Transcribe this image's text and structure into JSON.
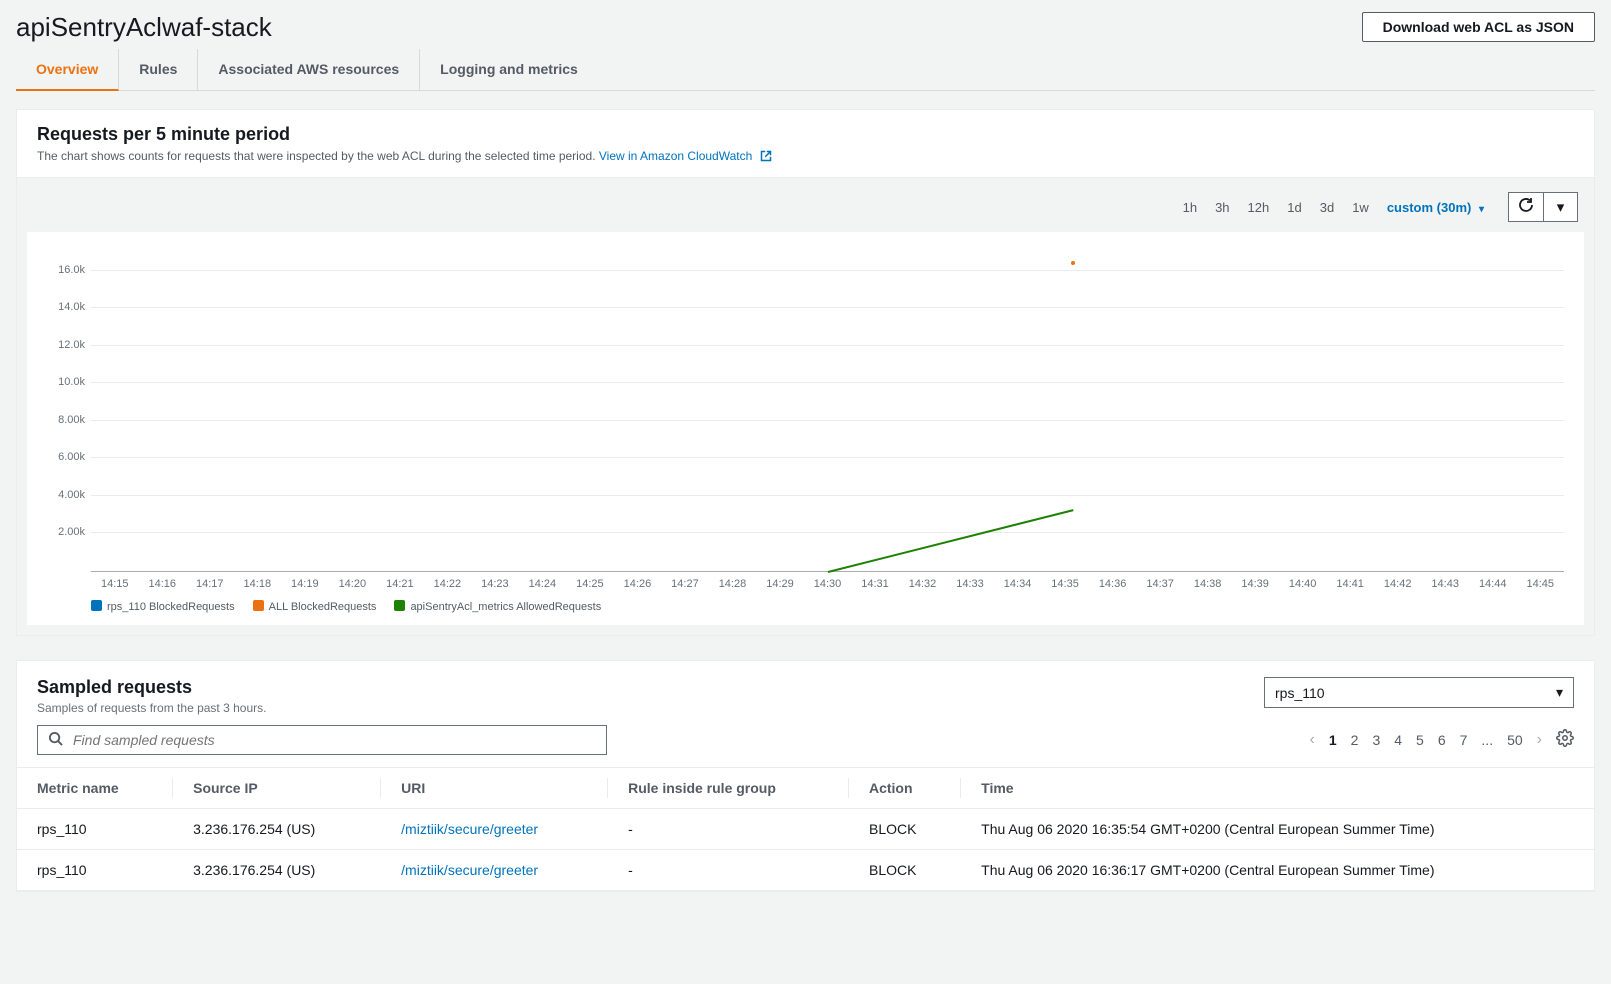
{
  "header": {
    "title": "apiSentryAclwaf-stack",
    "download_btn": "Download web ACL as JSON"
  },
  "tabs": [
    {
      "label": "Overview",
      "active": true
    },
    {
      "label": "Rules",
      "active": false
    },
    {
      "label": "Associated AWS resources",
      "active": false
    },
    {
      "label": "Logging and metrics",
      "active": false
    }
  ],
  "chart_panel": {
    "title": "Requests per 5 minute period",
    "subtitle": "The chart shows counts for requests that were inspected by the web ACL during the selected time period.",
    "cloudwatch_link": "View in Amazon CloudWatch",
    "time_ranges": [
      "1h",
      "3h",
      "12h",
      "1d",
      "3d",
      "1w"
    ],
    "custom_label": "custom (30m)"
  },
  "chart_data": {
    "type": "line",
    "title": "",
    "xlabel": "",
    "ylabel": "",
    "ylim": [
      0,
      17000
    ],
    "y_ticks": [
      "16.0k",
      "14.0k",
      "12.0k",
      "10.0k",
      "8.00k",
      "6.00k",
      "4.00k",
      "2.00k"
    ],
    "x_ticks": [
      "14:15",
      "14:16",
      "14:17",
      "14:18",
      "14:19",
      "14:20",
      "14:21",
      "14:22",
      "14:23",
      "14:24",
      "14:25",
      "14:26",
      "14:27",
      "14:28",
      "14:29",
      "14:30",
      "14:31",
      "14:32",
      "14:33",
      "14:34",
      "14:35",
      "14:36",
      "14:37",
      "14:38",
      "14:39",
      "14:40",
      "14:41",
      "14:42",
      "14:43",
      "14:44",
      "14:45"
    ],
    "series": [
      {
        "name": "rps_110 BlockedRequests",
        "color": "#0073bb",
        "points": []
      },
      {
        "name": "ALL BlockedRequests",
        "color": "#ec7211",
        "points": [
          {
            "x": "14:35",
            "y": 16400
          }
        ]
      },
      {
        "name": "apiSentryAcl_metrics AllowedRequests",
        "color": "#1d8102",
        "points": [
          {
            "x": "14:30",
            "y": 0
          },
          {
            "x": "14:35",
            "y": 3300
          }
        ]
      }
    ],
    "legend": [
      {
        "swatch": "#0073bb",
        "label": "rps_110 BlockedRequests"
      },
      {
        "swatch": "#ec7211",
        "label": "ALL BlockedRequests"
      },
      {
        "swatch": "#1d8102",
        "label": "apiSentryAcl_metrics AllowedRequests"
      }
    ]
  },
  "sampled": {
    "title": "Sampled requests",
    "subtitle": "Samples of requests from the past 3 hours.",
    "dropdown_value": "rps_110",
    "search_placeholder": "Find sampled requests",
    "pages": [
      "1",
      "2",
      "3",
      "4",
      "5",
      "6",
      "7",
      "...",
      "50"
    ],
    "current_page": "1",
    "columns": [
      "Metric name",
      "Source IP",
      "URI",
      "Rule inside rule group",
      "Action",
      "Time"
    ],
    "rows": [
      {
        "metric": "rps_110",
        "ip": "3.236.176.254 (US)",
        "uri": "/miztiik/secure/greeter",
        "rule": "-",
        "action": "BLOCK",
        "time": "Thu Aug 06 2020 16:35:54 GMT+0200 (Central European Summer Time)"
      },
      {
        "metric": "rps_110",
        "ip": "3.236.176.254 (US)",
        "uri": "/miztiik/secure/greeter",
        "rule": "-",
        "action": "BLOCK",
        "time": "Thu Aug 06 2020 16:36:17 GMT+0200 (Central European Summer Time)"
      }
    ]
  }
}
